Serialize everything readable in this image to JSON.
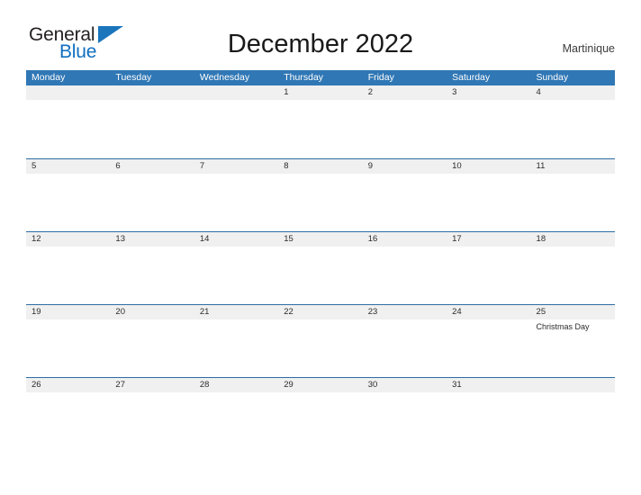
{
  "brand": {
    "name_part1": "General",
    "name_part2": "Blue",
    "triangle_icon": "triangle-icon",
    "accent_color": "#1b75bb"
  },
  "header": {
    "title": "December 2022",
    "region": "Martinique"
  },
  "colors": {
    "header_blue": "#3077b5",
    "rule_blue": "#2e6da4",
    "date_band_gray": "#f0f0f0",
    "text_dark": "#2b2b2b"
  },
  "calendar": {
    "month": "December",
    "year": "2022",
    "weekday_headers": [
      "Monday",
      "Tuesday",
      "Wednesday",
      "Thursday",
      "Friday",
      "Saturday",
      "Sunday"
    ],
    "weeks": [
      {
        "days": [
          {
            "date": "",
            "events": []
          },
          {
            "date": "",
            "events": []
          },
          {
            "date": "",
            "events": []
          },
          {
            "date": "1",
            "events": []
          },
          {
            "date": "2",
            "events": []
          },
          {
            "date": "3",
            "events": []
          },
          {
            "date": "4",
            "events": []
          }
        ]
      },
      {
        "days": [
          {
            "date": "5",
            "events": []
          },
          {
            "date": "6",
            "events": []
          },
          {
            "date": "7",
            "events": []
          },
          {
            "date": "8",
            "events": []
          },
          {
            "date": "9",
            "events": []
          },
          {
            "date": "10",
            "events": []
          },
          {
            "date": "11",
            "events": []
          }
        ]
      },
      {
        "days": [
          {
            "date": "12",
            "events": []
          },
          {
            "date": "13",
            "events": []
          },
          {
            "date": "14",
            "events": []
          },
          {
            "date": "15",
            "events": []
          },
          {
            "date": "16",
            "events": []
          },
          {
            "date": "17",
            "events": []
          },
          {
            "date": "18",
            "events": []
          }
        ]
      },
      {
        "days": [
          {
            "date": "19",
            "events": []
          },
          {
            "date": "20",
            "events": []
          },
          {
            "date": "21",
            "events": []
          },
          {
            "date": "22",
            "events": []
          },
          {
            "date": "23",
            "events": []
          },
          {
            "date": "24",
            "events": []
          },
          {
            "date": "25",
            "events": [
              "Christmas Day"
            ]
          }
        ]
      },
      {
        "days": [
          {
            "date": "26",
            "events": []
          },
          {
            "date": "27",
            "events": []
          },
          {
            "date": "28",
            "events": []
          },
          {
            "date": "29",
            "events": []
          },
          {
            "date": "30",
            "events": []
          },
          {
            "date": "31",
            "events": []
          },
          {
            "date": "",
            "events": []
          }
        ]
      }
    ]
  }
}
